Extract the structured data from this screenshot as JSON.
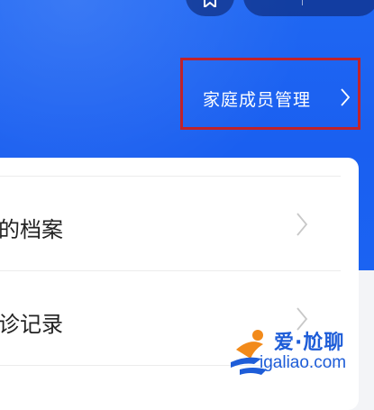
{
  "header": {
    "family_management_label": "家庭成员管理"
  },
  "icons": {
    "favorite": "star-icon",
    "chevron": "chevron-right-icon"
  },
  "list": {
    "items": [
      {
        "label": "的档案"
      },
      {
        "label": "诊记录"
      }
    ]
  },
  "watermark": {
    "line1": "爱·尬聊",
    "line2": "igaliao.com"
  },
  "colors": {
    "brand_blue": "#1a5ff0",
    "highlight_red": "#c0222a"
  }
}
